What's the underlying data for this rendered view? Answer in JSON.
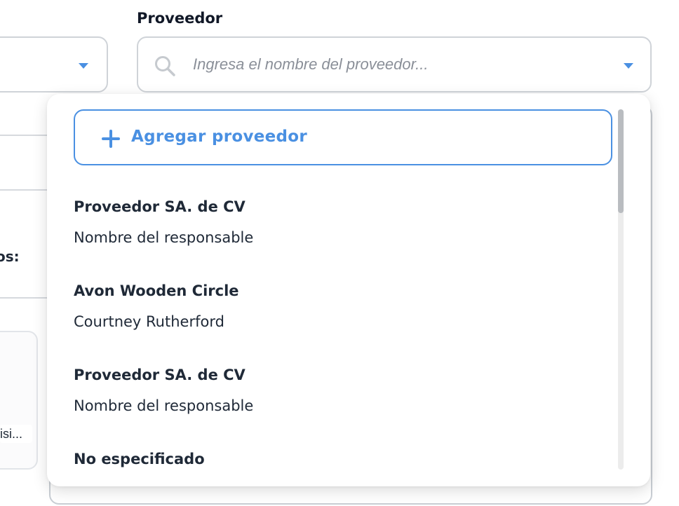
{
  "left_fragments": {
    "label_fragment": "os:",
    "chip_fragment": "isi..."
  },
  "supplier_field": {
    "label": "Proveedor",
    "placeholder": "Ingresa el nombre del proveedor...",
    "value": ""
  },
  "dropdown": {
    "add_button_label": "Agregar proveedor",
    "options": [
      {
        "name": "Proveedor SA. de CV",
        "contact": "Nombre del responsable"
      },
      {
        "name": "Avon Wooden Circle",
        "contact": "Courtney Rutherford"
      },
      {
        "name": "Proveedor SA. de CV",
        "contact": "Nombre del responsable"
      },
      {
        "name": "No especificado",
        "contact": ""
      }
    ]
  },
  "colors": {
    "accent": "#4a90e2",
    "border": "#cfd3d8",
    "text": "#1f2937",
    "placeholder": "#8a8f98"
  },
  "icons": {
    "search": "search-icon",
    "caret": "caret-down-icon",
    "plus": "plus-icon"
  }
}
